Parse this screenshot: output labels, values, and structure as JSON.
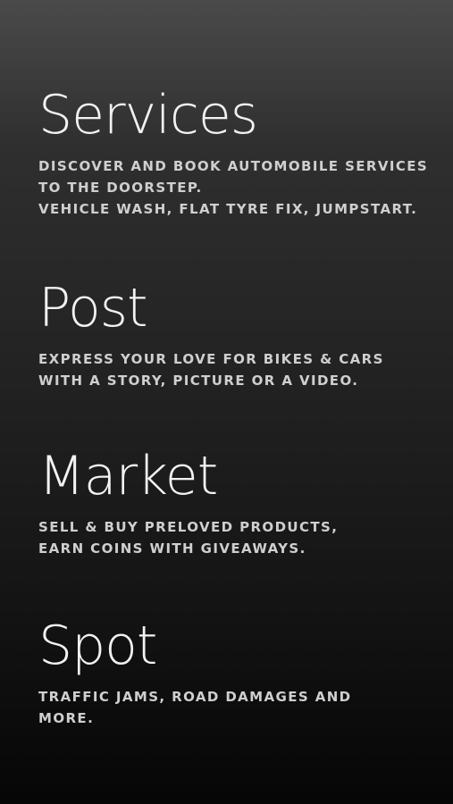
{
  "features": [
    {
      "title": "Services",
      "lines": [
        "DISCOVER AND BOOK AUTOMOBILE SERVICES",
        "TO THE DOORSTEP.",
        "VEHICLE WASH, FLAT TYRE FIX, JUMPSTART."
      ]
    },
    {
      "title": "Post",
      "lines": [
        "EXPRESS YOUR LOVE FOR BIKES & CARS",
        "WITH A STORY, PICTURE OR A VIDEO."
      ]
    },
    {
      "title": "Market",
      "lines": [
        "SELL & BUY PRELOVED PRODUCTS,",
        "EARN COINS WITH GIVEAWAYS."
      ]
    },
    {
      "title": "Spot",
      "lines": [
        "TRAFFIC JAMS, ROAD DAMAGES AND",
        "MORE."
      ]
    }
  ]
}
